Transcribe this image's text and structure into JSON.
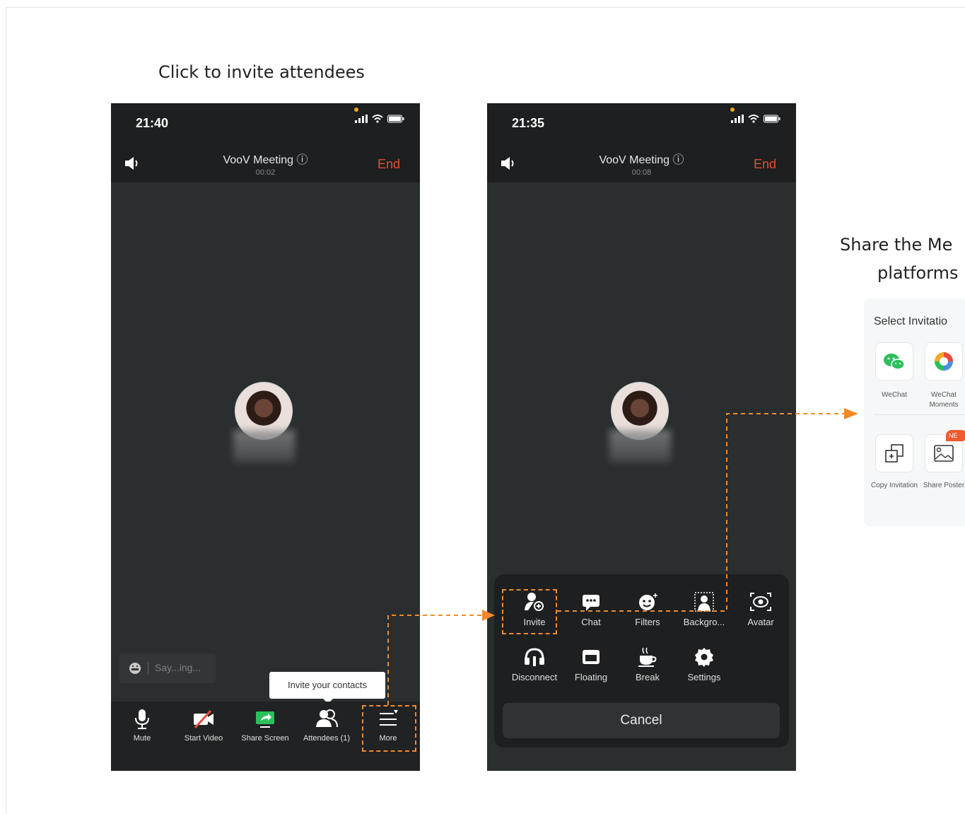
{
  "captions": {
    "left": "Click to invite attendees",
    "right_line1": "Share the Me",
    "right_line2": "platforms"
  },
  "phone1": {
    "time": "21:40",
    "title": "VooV Meeting ⓘ",
    "duration": "00:02",
    "end_label": "End",
    "chat_placeholder": "Say...ing...",
    "tooltip": "Invite your contacts",
    "toolbar": [
      {
        "label": "Mute",
        "icon": "mic-icon"
      },
      {
        "label": "Start Video",
        "icon": "video-off-icon"
      },
      {
        "label": "Share Screen",
        "icon": "share-screen-icon"
      },
      {
        "label": "Attendees (1)",
        "icon": "attendees-icon"
      },
      {
        "label": "More",
        "icon": "more-icon"
      }
    ]
  },
  "phone2": {
    "time": "21:35",
    "title": "VooV Meeting ⓘ",
    "duration": "00:08",
    "end_label": "End",
    "menu_row1": [
      {
        "label": "Invite",
        "icon": "invite-icon"
      },
      {
        "label": "Chat",
        "icon": "chat-icon"
      },
      {
        "label": "Filters",
        "icon": "filters-icon"
      },
      {
        "label": "Backgro...",
        "icon": "background-icon"
      },
      {
        "label": "Avatar",
        "icon": "avatar-icon"
      }
    ],
    "menu_row2": [
      {
        "label": "Disconnect",
        "icon": "headset-icon"
      },
      {
        "label": "Floating",
        "icon": "floating-window-icon"
      },
      {
        "label": "Break",
        "icon": "coffee-icon"
      },
      {
        "label": "Settings",
        "icon": "gear-icon"
      }
    ],
    "cancel_label": "Cancel"
  },
  "invite_panel": {
    "title": "Select Invitatio",
    "options": [
      {
        "label": "WeChat",
        "icon": "wechat-icon"
      },
      {
        "label": "WeChat Moments",
        "icon": "moments-icon"
      },
      {
        "label": "Copy Invitation",
        "icon": "copy-icon"
      },
      {
        "label": "Share Poster",
        "icon": "poster-icon"
      }
    ],
    "badge": "NE"
  },
  "colors": {
    "accent_dashed": "#f28a2a",
    "end_red": "#e84a3c",
    "phone_bg": "#2b2e2f",
    "wechat_green": "#2ac05b"
  }
}
